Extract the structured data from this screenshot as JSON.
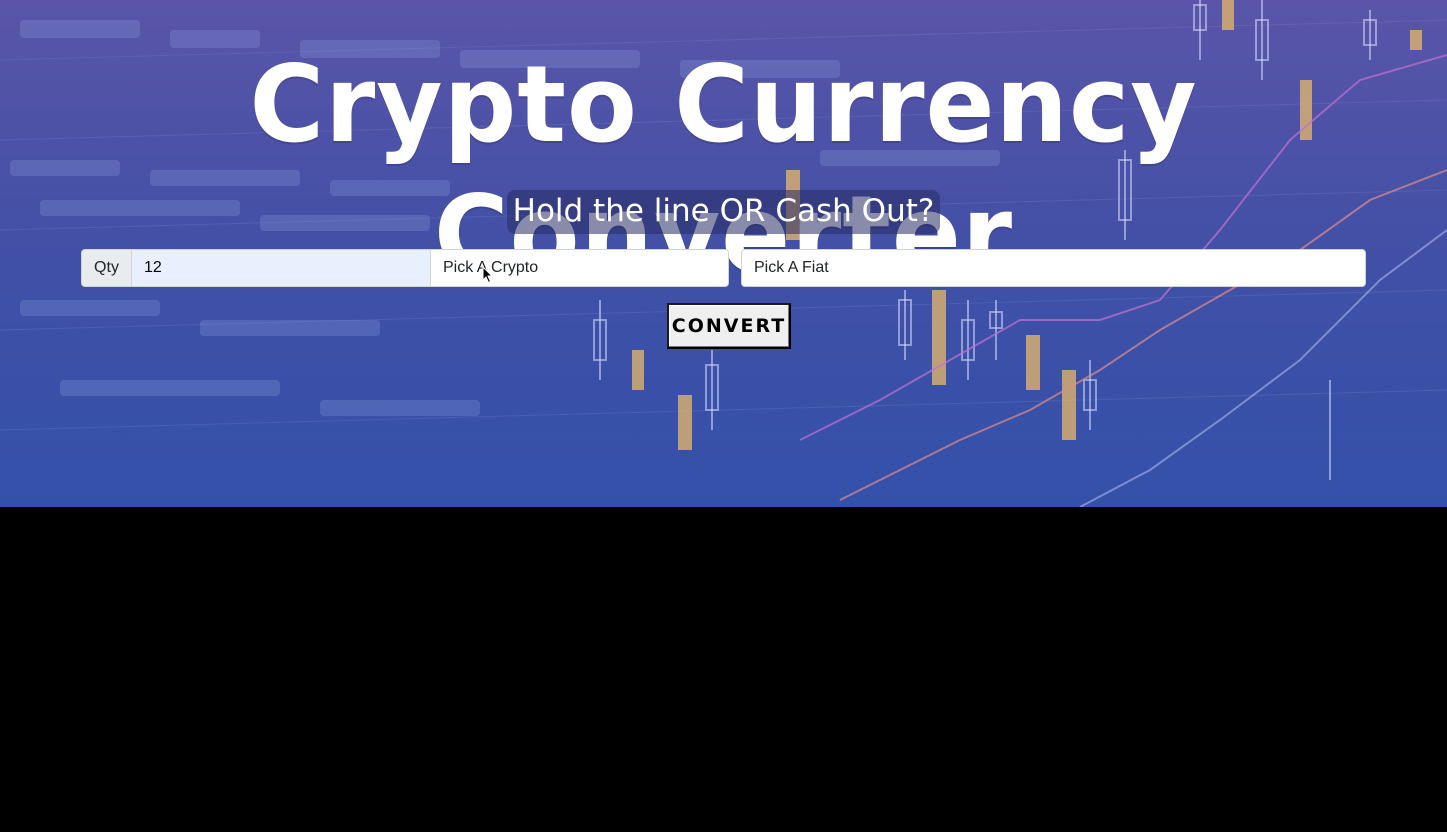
{
  "page": {
    "title": "Crypto Currency Converter",
    "subtitle": "Hold the line OR Cash Out?"
  },
  "form": {
    "qty_label": "Qty",
    "qty_value": "12",
    "crypto_select": "Pick A Crypto",
    "fiat_select": "Pick A Fiat",
    "convert_label": "CONVERT"
  },
  "colors": {
    "hero_background": "#3f4ea5",
    "title_text": "#ffffff",
    "input_autofill": "#e8f0fe",
    "page_background": "#000000"
  },
  "icons": {
    "mouse_cursor": "mouse-cursor-icon"
  }
}
